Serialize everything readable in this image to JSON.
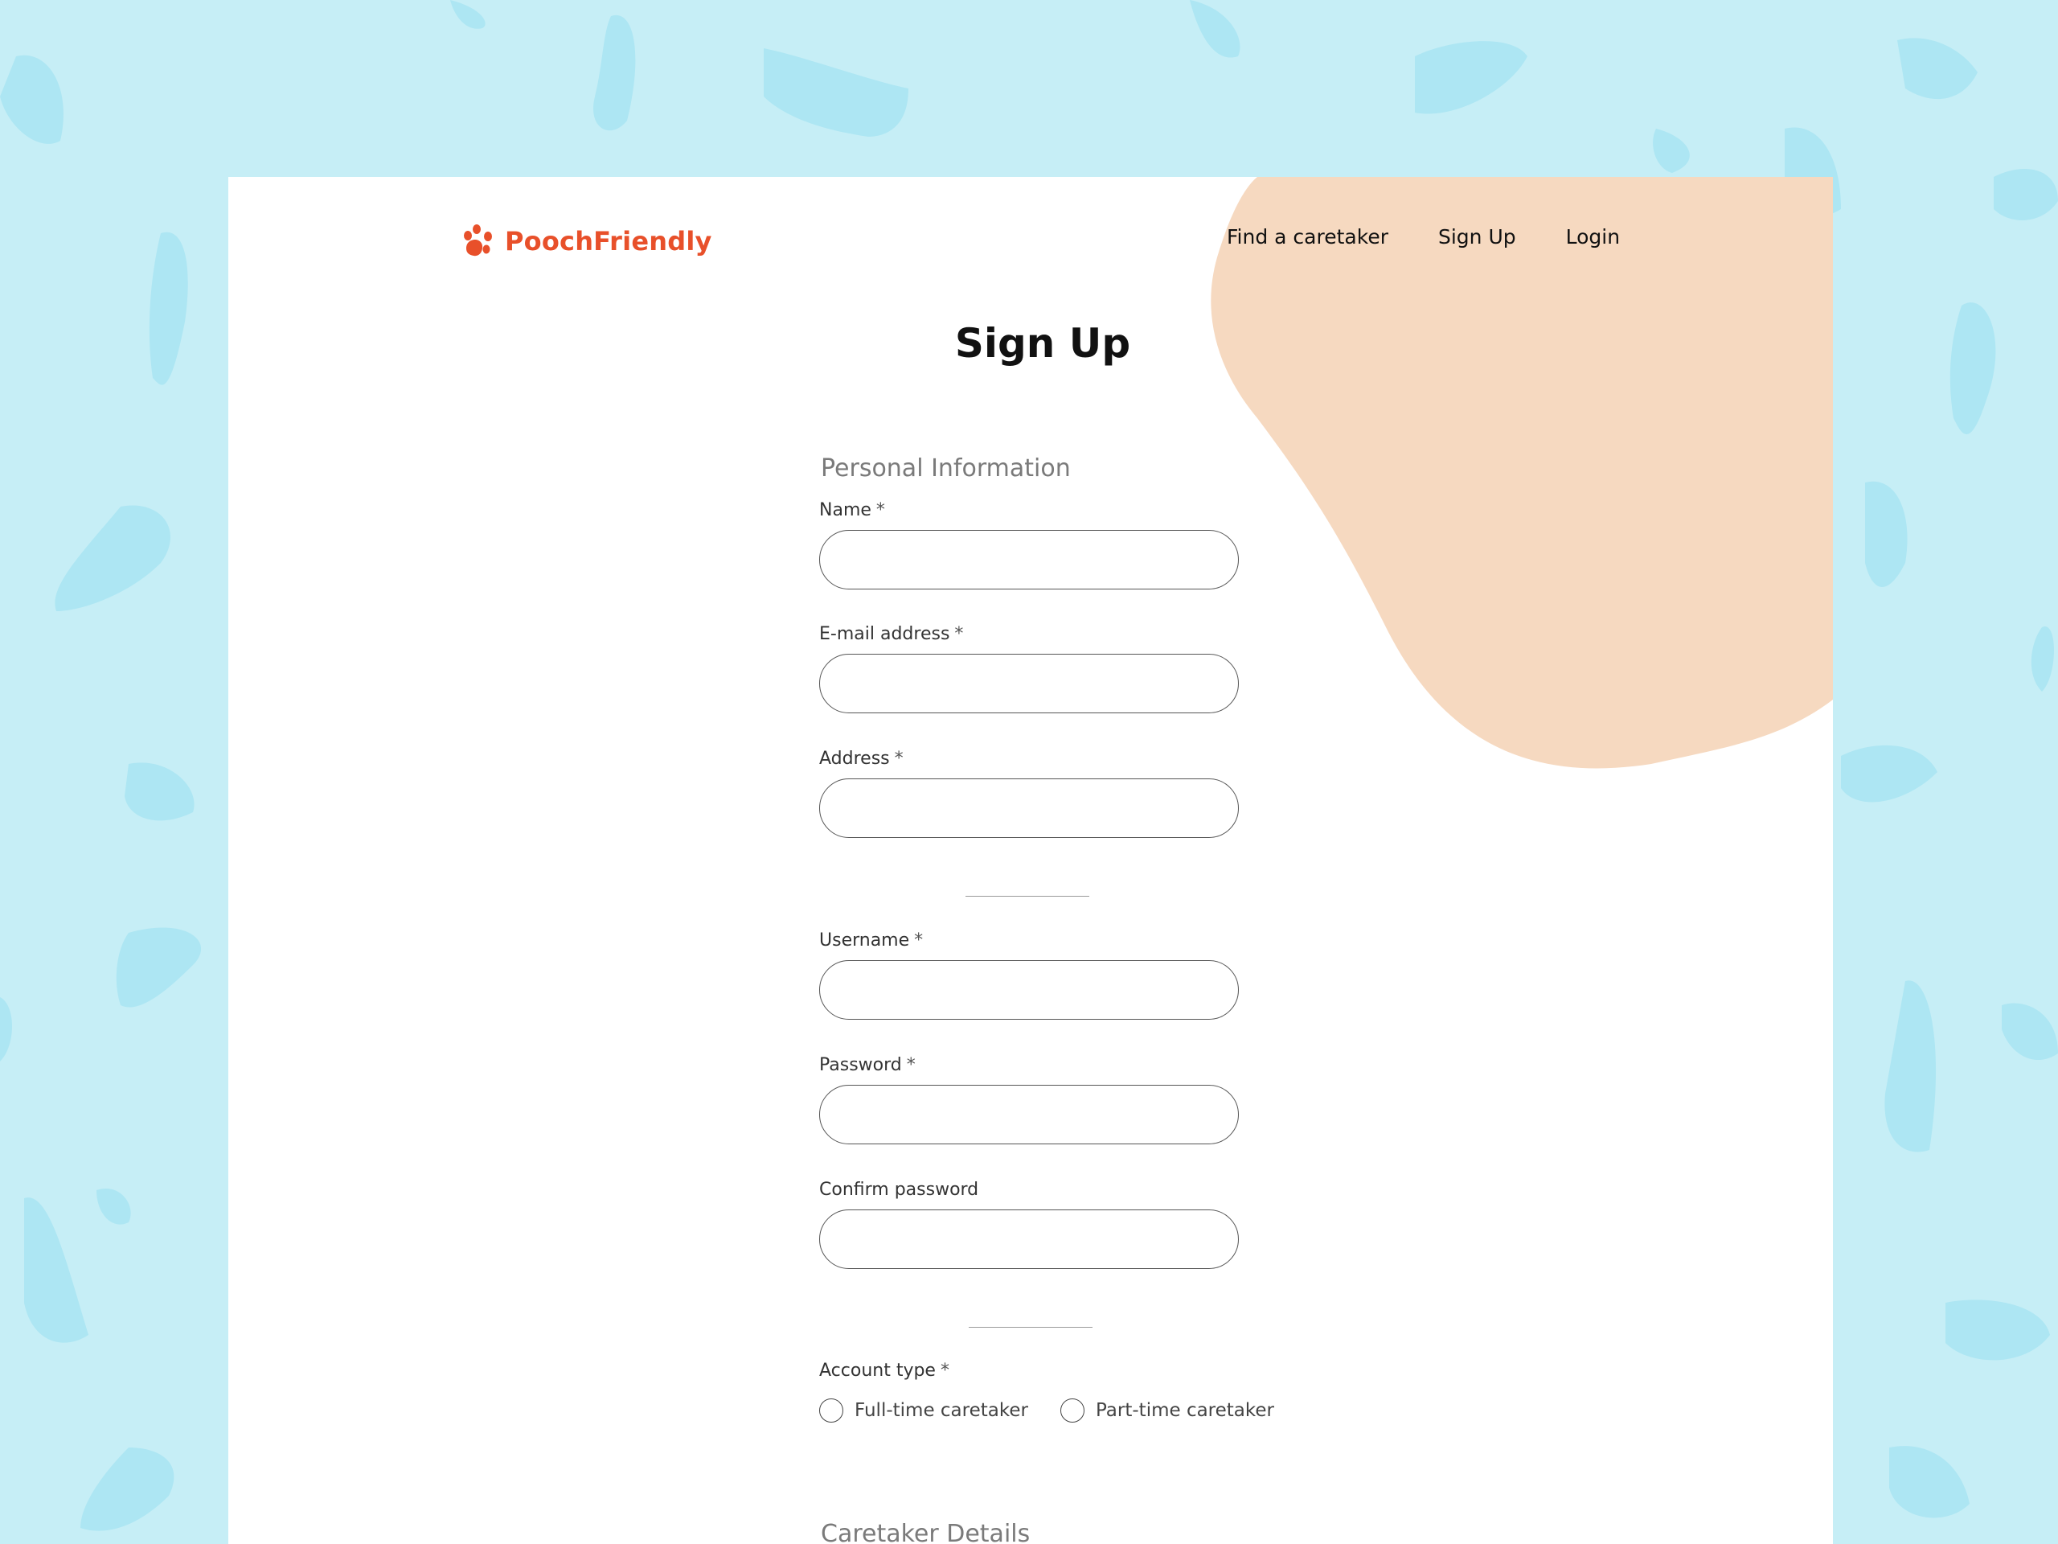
{
  "brand": {
    "name": "PoochFriendly",
    "color": "#e8502a"
  },
  "nav": {
    "items": [
      "Find a caretaker",
      "Sign Up",
      "Login"
    ]
  },
  "page_title": "Sign Up",
  "sections": {
    "personal": "Personal Information",
    "caretaker": "Caretaker Details"
  },
  "fields": {
    "name": {
      "label": "Name",
      "value": ""
    },
    "email": {
      "label": "E-mail address",
      "value": ""
    },
    "address": {
      "label": "Address",
      "value": ""
    },
    "username": {
      "label": "Username",
      "value": ""
    },
    "password": {
      "label": "Password",
      "value": ""
    },
    "confirm_password": {
      "label": "Confirm password",
      "value": ""
    }
  },
  "required_marker": "*",
  "account_type": {
    "label": "Account type",
    "options": [
      "Full-time caretaker",
      "Part-time caretaker"
    ],
    "selected": null
  },
  "colors": {
    "background": "#c6eef6",
    "pattern": "#ade6f3",
    "blob": "#f6d9c0"
  },
  "icons": [
    "paw-icon"
  ]
}
